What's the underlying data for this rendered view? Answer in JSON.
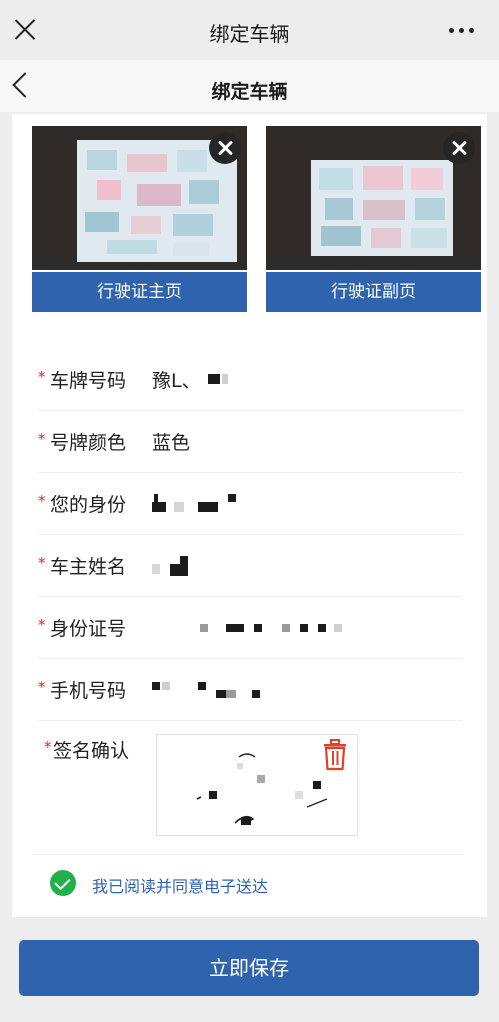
{
  "topbar": {
    "title": "绑定车辆"
  },
  "navbar": {
    "title": "绑定车辆"
  },
  "photos": [
    {
      "caption": "行驶证主页"
    },
    {
      "caption": "行驶证副页"
    }
  ],
  "form": {
    "required_mark": "*",
    "plate_number": {
      "label": "车牌号码",
      "value": "豫L、"
    },
    "plate_color": {
      "label": "号牌颜色",
      "value": "蓝色"
    },
    "identity": {
      "label": "您的身份"
    },
    "owner_name": {
      "label": "车主姓名"
    },
    "id_number": {
      "label": "身份证号"
    },
    "phone": {
      "label": "手机号码"
    },
    "signature": {
      "label": "签名确认"
    }
  },
  "agreement": {
    "text": "我已阅读并同意电子送达",
    "checked": true
  },
  "save_button": {
    "label": "立即保存"
  },
  "colors": {
    "primary": "#2f63ae",
    "required": "#d42b2b",
    "check": "#22b04b",
    "trash": "#d9432f"
  },
  "icons": [
    "close-icon",
    "more-icon",
    "back-icon",
    "remove-photo-icon",
    "trash-icon",
    "check-circle-icon"
  ]
}
